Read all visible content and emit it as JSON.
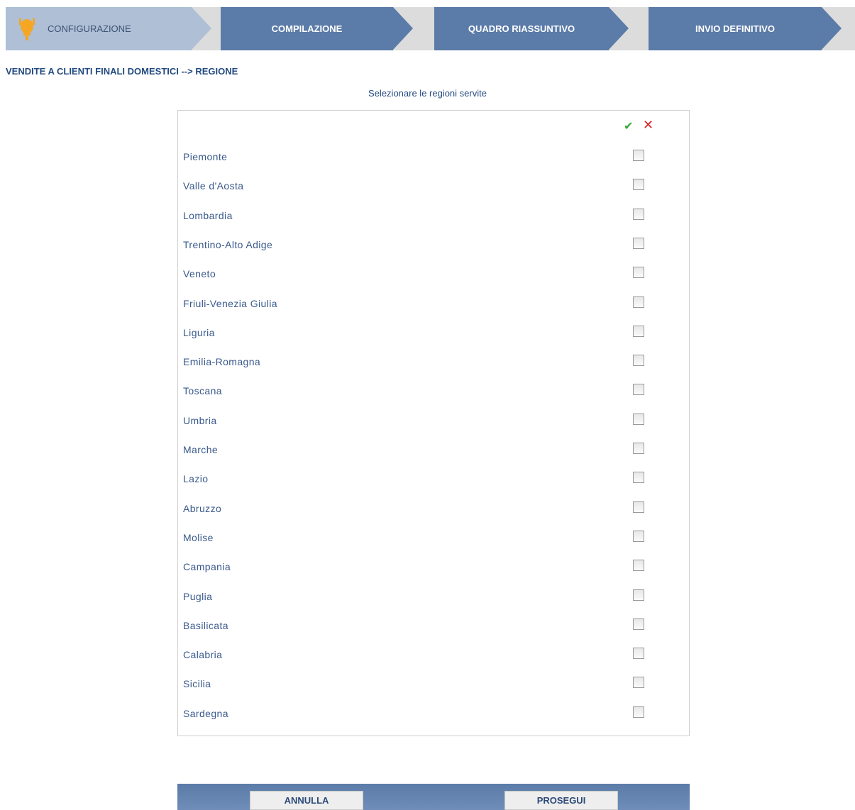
{
  "steps": [
    {
      "label": "CONFIGURAZIONE",
      "state": "active"
    },
    {
      "label": "COMPILAZIONE",
      "state": "inactive"
    },
    {
      "label": "QUADRO RIASSUNTIVO",
      "state": "inactive"
    },
    {
      "label": "INVIO DEFINITIVO",
      "state": "inactive"
    }
  ],
  "breadcrumb": "VENDITE A CLIENTI FINALI DOMESTICI --> REGIONE",
  "subtitle": "Selezionare le regioni servite",
  "select_all_glyph": "✔",
  "deselect_all_glyph": "✕",
  "regions": [
    {
      "name": "Piemonte",
      "checked": false
    },
    {
      "name": "Valle d'Aosta",
      "checked": false
    },
    {
      "name": "Lombardia",
      "checked": false
    },
    {
      "name": "Trentino-Alto Adige",
      "checked": false
    },
    {
      "name": "Veneto",
      "checked": false
    },
    {
      "name": "Friuli-Venezia Giulia",
      "checked": false
    },
    {
      "name": "Liguria",
      "checked": false
    },
    {
      "name": "Emilia-Romagna",
      "checked": false
    },
    {
      "name": "Toscana",
      "checked": false
    },
    {
      "name": "Umbria",
      "checked": false
    },
    {
      "name": "Marche",
      "checked": false
    },
    {
      "name": "Lazio",
      "checked": false
    },
    {
      "name": "Abruzzo",
      "checked": false
    },
    {
      "name": "Molise",
      "checked": false
    },
    {
      "name": "Campania",
      "checked": false
    },
    {
      "name": "Puglia",
      "checked": false
    },
    {
      "name": "Basilicata",
      "checked": false
    },
    {
      "name": "Calabria",
      "checked": false
    },
    {
      "name": "Sicilia",
      "checked": false
    },
    {
      "name": "Sardegna",
      "checked": false
    }
  ],
  "buttons": {
    "cancel": "ANNULLA",
    "proceed": "PROSEGUI"
  },
  "colors": {
    "step_active": "#aebfd6",
    "step_inactive": "#5b7ba8",
    "text_blue": "#234a80"
  }
}
